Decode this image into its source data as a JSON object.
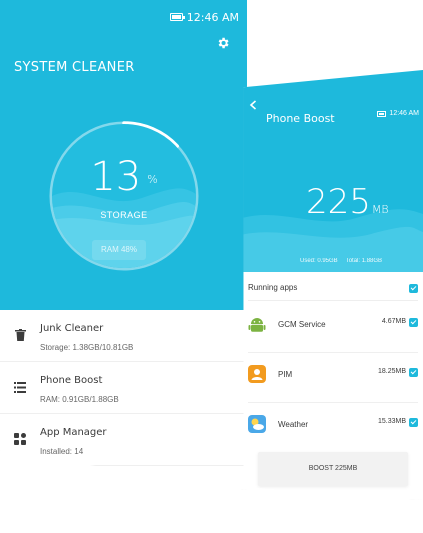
{
  "left_screen": {
    "status": {
      "time": "12:46 AM"
    },
    "title": "SYSTEM CLEANER",
    "storage_dial": {
      "percent": "13",
      "percent_unit": "%",
      "label": "STORAGE",
      "ring_fill_fraction": 0.13,
      "ram_badge": "RAM 48%"
    },
    "list": [
      {
        "title": "Junk Cleaner",
        "subtitle": "Storage: 1.38GB/10.81GB",
        "icon": "trash-icon"
      },
      {
        "title": "Phone Boost",
        "subtitle": "RAM: 0.91GB/1.88GB",
        "icon": "stack-icon"
      },
      {
        "title": "App Manager",
        "subtitle": "Installed: 14",
        "icon": "apps-grid-icon"
      }
    ]
  },
  "right_screen": {
    "status": {
      "time": "12:46 AM"
    },
    "title": "Phone Boost",
    "boost": {
      "value": "225",
      "unit": "MB"
    },
    "used": "Used: 0.95GB",
    "total": "Total: 1.88GB",
    "running_header": "Running apps",
    "apps": [
      {
        "name": "GCM Service",
        "size": "4.67MB",
        "icon": "android-icon"
      },
      {
        "name": "PIM",
        "size": "18.25MB",
        "icon": "contacts-icon"
      },
      {
        "name": "Weather",
        "size": "15.33MB",
        "icon": "weather-icon"
      }
    ],
    "boost_button": "BOOST 225MB"
  },
  "colors": {
    "accent": "#1eb9dc",
    "android_green": "#7cb342",
    "contacts_orange": "#f29b1f",
    "weather_blue": "#4aa8e8"
  }
}
